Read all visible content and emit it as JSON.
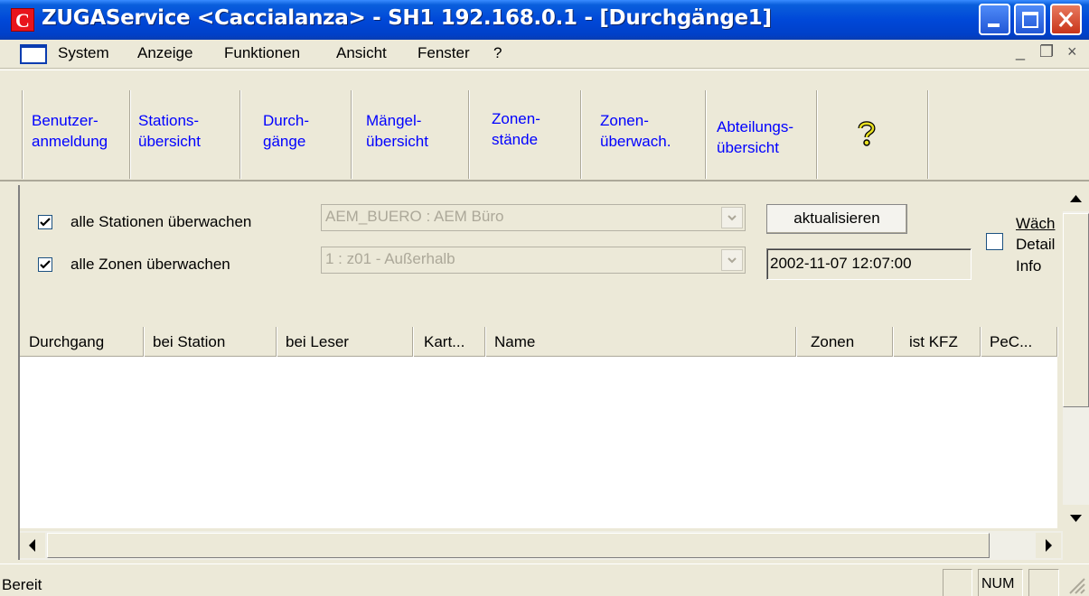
{
  "window": {
    "title": "ZUGAService <Caccialanza> - SH1 192.168.0.1 - [Durchgänge1]",
    "logo_letter": "C"
  },
  "menu": {
    "items": [
      "System",
      "Anzeige",
      "Funktionen",
      "Ansicht",
      "Fenster",
      "?"
    ]
  },
  "toolbar": {
    "buttons": [
      {
        "line1": "Benutzer-",
        "line2": "anmeldung"
      },
      {
        "line1": "Stations-",
        "line2": "übersicht"
      },
      {
        "line1": "Durch-",
        "line2": "gänge"
      },
      {
        "line1": "Mängel-",
        "line2": "übersicht"
      },
      {
        "line1": "Zonen-",
        "line2": "stände"
      },
      {
        "line1": "Zonen-",
        "line2": "überwach."
      },
      {
        "line1": "Abteilungs-",
        "line2": "übersicht"
      }
    ],
    "help_icon": "question-mark-icon"
  },
  "filters": {
    "all_stations_label": "alle Stationen überwachen",
    "all_stations_checked": true,
    "all_zones_label": "alle Zonen überwachen",
    "all_zones_checked": true,
    "station_combo_value": "AEM_BUERO : AEM Büro",
    "zone_combo_value": "1 : z01 - Außerhalb",
    "refresh_button": "aktualisieren",
    "timestamp": "2002-11-07 12:07:00",
    "watch_label_1": "Wäch",
    "watch_label_2": "Detail",
    "watch_label_3": "Info",
    "watch_checked": false
  },
  "list": {
    "columns": [
      "Durchgang",
      "bei Station",
      "bei Leser",
      "Kart...",
      "Name",
      "Zonen",
      "ist KFZ",
      "PeC..."
    ],
    "rows": []
  },
  "status": {
    "text": "Bereit",
    "num_indicator": "NUM"
  },
  "colors": {
    "titlebar": "#0048d8",
    "toolbar_link": "#0000ff",
    "face": "#ece9d8"
  }
}
